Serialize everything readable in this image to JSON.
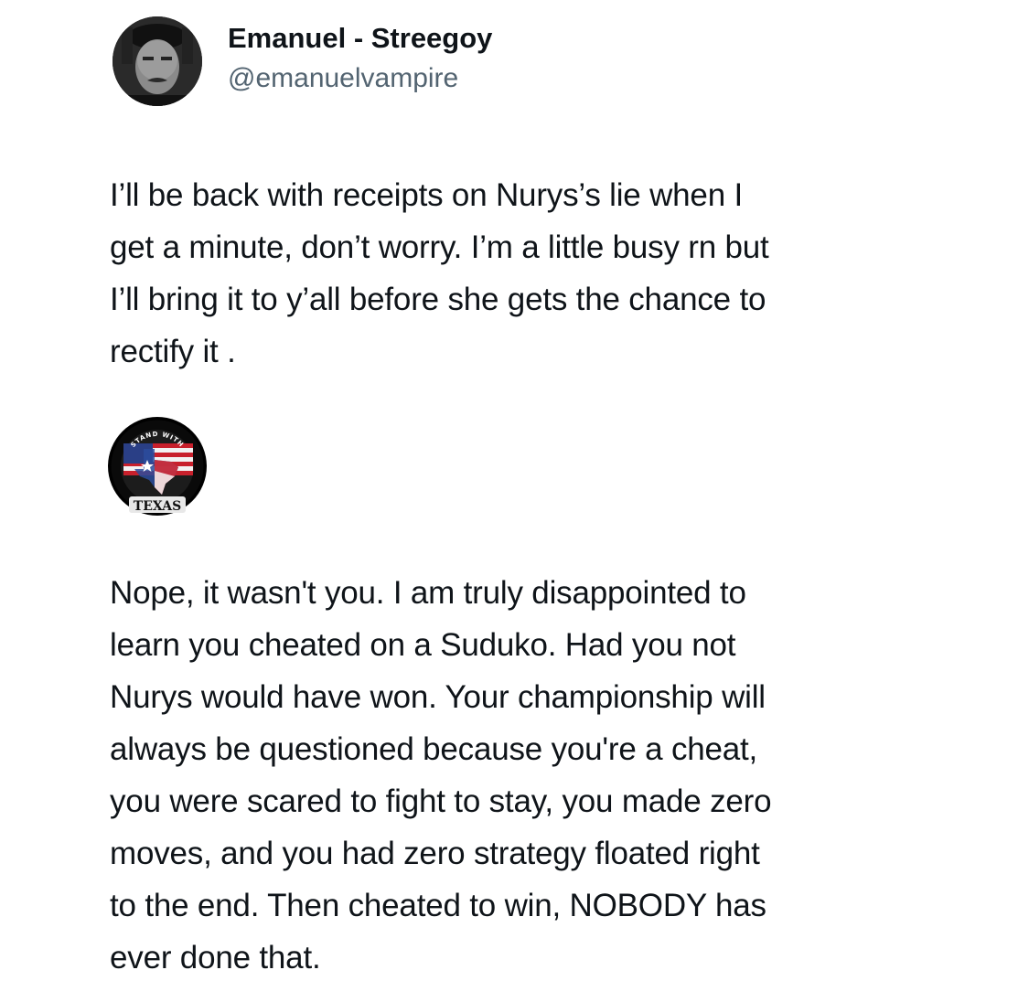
{
  "author": {
    "display_name": "Emanuel - Streegoy",
    "handle": "@emanuelvampire",
    "avatar_icon": "profile-photo"
  },
  "post": {
    "text": "I’ll be back with receipts on Nurys’s lie when I\nget a minute, don’t worry. I’m a little busy rn but\nI’ll bring it to y’all before she gets the chance to\nrectify it ."
  },
  "reply": {
    "badge_icon": "stand-with-texas-badge",
    "badge_top_text": "STAND WITH",
    "badge_bottom_text": "TEXAS",
    "text": "Nope, it wasn't you. I am truly disappointed to\nlearn you cheated on a Suduko. Had you not\nNurys would have won. Your championship will\nalways be questioned because you're a cheat,\nyou were scared to fight to stay, you made zero\nmoves, and you had zero strategy floated right\nto the end. Then cheated to win, NOBODY has\never done that."
  },
  "colors": {
    "text": "#0f1419",
    "secondary": "#536471",
    "background": "#ffffff"
  }
}
